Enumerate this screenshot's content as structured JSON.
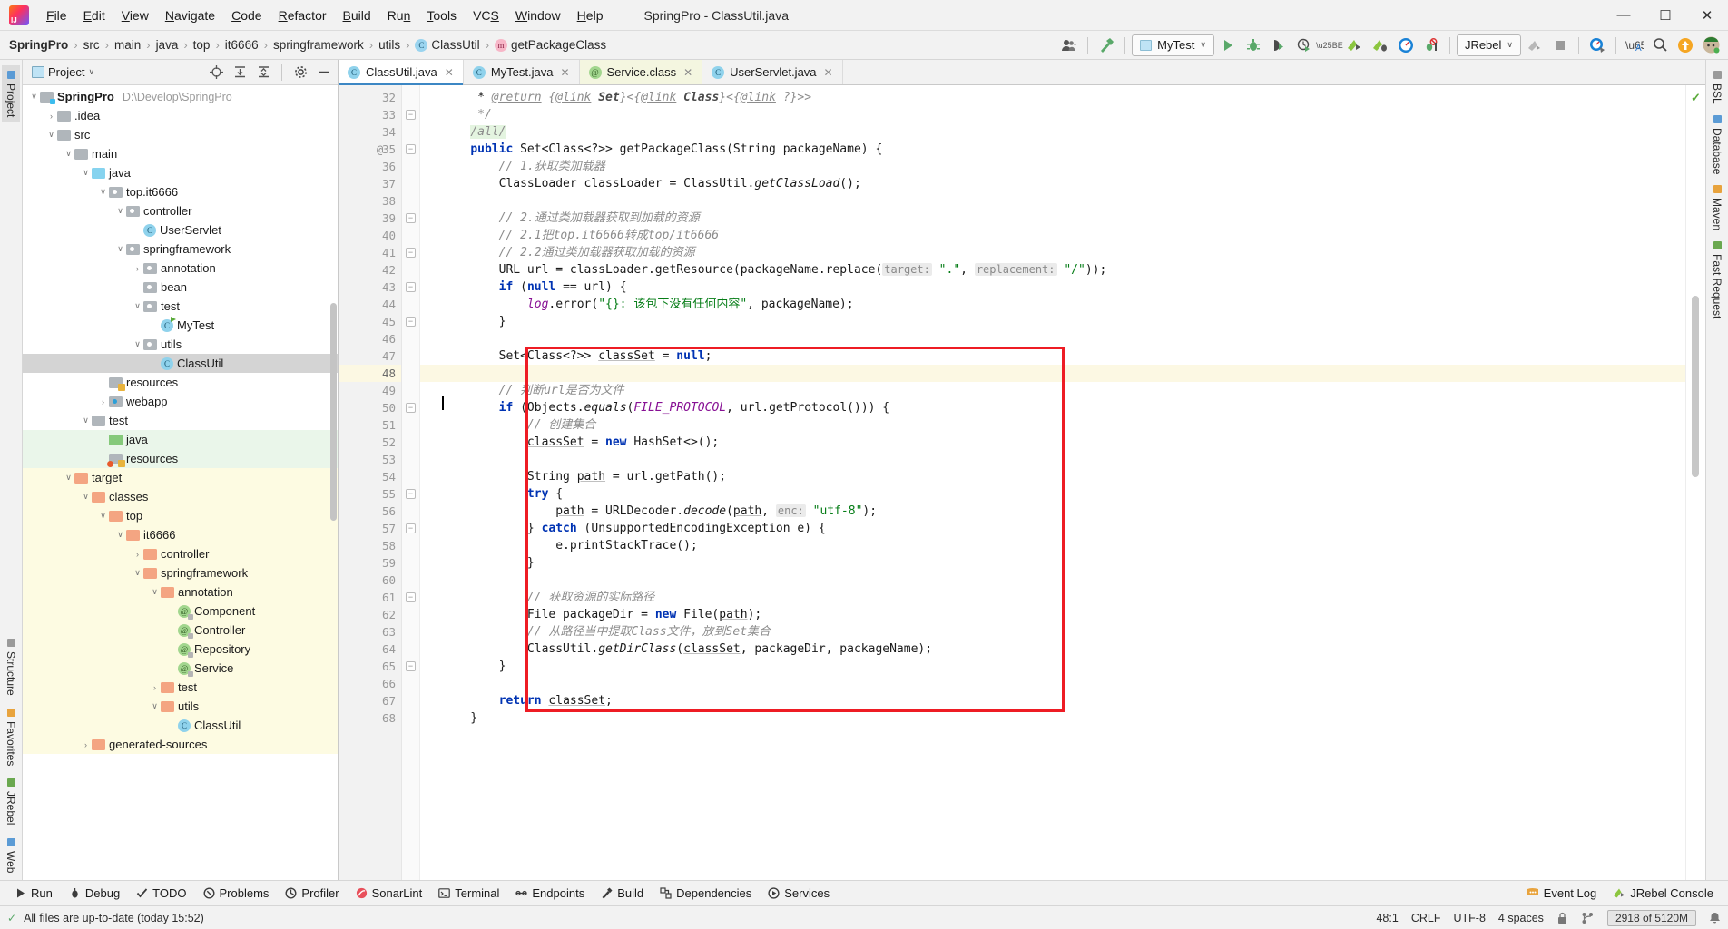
{
  "window": {
    "title": "SpringPro - ClassUtil.java",
    "minimize": "—",
    "maximize": "☐",
    "close": "✕"
  },
  "menu": {
    "items": [
      "File",
      "Edit",
      "View",
      "Navigate",
      "Code",
      "Refactor",
      "Build",
      "Run",
      "Tools",
      "VCS",
      "Window",
      "Help"
    ]
  },
  "breadcrumb": {
    "items": [
      "SpringPro",
      "src",
      "main",
      "java",
      "top",
      "it6666",
      "springframework",
      "utils",
      "ClassUtil",
      "getPackageClass"
    ],
    "separator": "›"
  },
  "toolbar": {
    "run_config": "MyTest",
    "jrebel": "JRebel",
    "caret": "∨",
    "icons": [
      "user-avatar-icon",
      "hammer-build-icon",
      "run-icon",
      "debug-icon",
      "run-with-coverage-icon",
      "profile-icon",
      "jrebel-run-icon",
      "jrebel-debug-icon",
      "jrebel-monitor-icon",
      "stop-debug-icon",
      "jrebel-deploy-icon",
      "stop-icon",
      "jrebel-console-icon",
      "translate-icon",
      "search-everywhere-icon",
      "update-icon",
      "account-avatar-icon"
    ]
  },
  "left_rail": {
    "items": [
      "Project",
      "Structure",
      "Favorites",
      "JRebel",
      "Web"
    ]
  },
  "right_rail": {
    "items": [
      "BSL",
      "Database",
      "Maven",
      "Fast Request"
    ]
  },
  "project_panel": {
    "title": "Project",
    "caret": "∨",
    "header_buttons": [
      "locate-icon",
      "expand-all-icon",
      "collapse-all-icon",
      "settings-gear-icon",
      "hide-icon"
    ],
    "tree": [
      {
        "depth": 0,
        "arrow": "∨",
        "icon": "folder-module",
        "icon_class": "fi gray src",
        "label": "SpringPro",
        "bold": true,
        "path": "D:\\Develop\\SpringPro",
        "row_class": ""
      },
      {
        "depth": 1,
        "arrow": "›",
        "icon": "folder",
        "icon_class": "fi gray",
        "label": ".idea",
        "bold": false,
        "path": "",
        "row_class": ""
      },
      {
        "depth": 1,
        "arrow": "∨",
        "icon": "folder",
        "icon_class": "fi gray",
        "label": "src",
        "bold": false,
        "path": "",
        "row_class": ""
      },
      {
        "depth": 2,
        "arrow": "∨",
        "icon": "folder",
        "icon_class": "fi gray",
        "label": "main",
        "bold": false,
        "path": "",
        "row_class": ""
      },
      {
        "depth": 3,
        "arrow": "∨",
        "icon": "folder-source",
        "icon_class": "fi blue",
        "label": "java",
        "bold": false,
        "path": "",
        "row_class": ""
      },
      {
        "depth": 4,
        "arrow": "∨",
        "icon": "folder-package",
        "icon_class": "fi gray pkg",
        "label": "top.it6666",
        "bold": false,
        "path": "",
        "row_class": ""
      },
      {
        "depth": 5,
        "arrow": "∨",
        "icon": "folder-package",
        "icon_class": "fi gray pkg",
        "label": "controller",
        "bold": false,
        "path": "",
        "row_class": ""
      },
      {
        "depth": 6,
        "arrow": "",
        "icon": "java-class",
        "icon_class": "ci",
        "label": "UserServlet",
        "bold": false,
        "path": "",
        "row_class": ""
      },
      {
        "depth": 5,
        "arrow": "∨",
        "icon": "folder-package",
        "icon_class": "fi gray pkg",
        "label": "springframework",
        "bold": false,
        "path": "",
        "row_class": ""
      },
      {
        "depth": 6,
        "arrow": "›",
        "icon": "folder-package",
        "icon_class": "fi gray pkg",
        "label": "annotation",
        "bold": false,
        "path": "",
        "row_class": ""
      },
      {
        "depth": 6,
        "arrow": "",
        "icon": "folder-package",
        "icon_class": "fi gray pkg",
        "label": "bean",
        "bold": false,
        "path": "",
        "row_class": ""
      },
      {
        "depth": 6,
        "arrow": "∨",
        "icon": "folder-package",
        "icon_class": "fi gray pkg",
        "label": "test",
        "bold": false,
        "path": "",
        "row_class": ""
      },
      {
        "depth": 7,
        "arrow": "",
        "icon": "java-class-runnable",
        "icon_class": "ci runnable",
        "label": "MyTest",
        "bold": false,
        "path": "",
        "row_class": ""
      },
      {
        "depth": 6,
        "arrow": "∨",
        "icon": "folder-package",
        "icon_class": "fi gray pkg",
        "label": "utils",
        "bold": false,
        "path": "",
        "row_class": ""
      },
      {
        "depth": 7,
        "arrow": "",
        "icon": "java-class",
        "icon_class": "ci",
        "label": "ClassUtil",
        "bold": false,
        "path": "",
        "row_class": "sel"
      },
      {
        "depth": 4,
        "arrow": "",
        "icon": "folder-resources",
        "icon_class": "fi gray res",
        "label": "resources",
        "bold": false,
        "path": "",
        "row_class": ""
      },
      {
        "depth": 4,
        "arrow": "›",
        "icon": "folder-webapp",
        "icon_class": "fi gray web",
        "label": "webapp",
        "bold": false,
        "path": "",
        "row_class": ""
      },
      {
        "depth": 3,
        "arrow": "∨",
        "icon": "folder",
        "icon_class": "fi gray",
        "label": "test",
        "bold": false,
        "path": "",
        "row_class": ""
      },
      {
        "depth": 4,
        "arrow": "",
        "icon": "folder-test-source",
        "icon_class": "fi green",
        "label": "java",
        "bold": false,
        "path": "",
        "row_class": "green"
      },
      {
        "depth": 4,
        "arrow": "",
        "icon": "folder-test-resources",
        "icon_class": "fi gray webres",
        "label": "resources",
        "bold": false,
        "path": "",
        "row_class": "green"
      },
      {
        "depth": 2,
        "arrow": "∨",
        "icon": "folder-excluded",
        "icon_class": "fi orange",
        "label": "target",
        "bold": false,
        "path": "",
        "row_class": "yellow"
      },
      {
        "depth": 3,
        "arrow": "∨",
        "icon": "folder-excluded",
        "icon_class": "fi orange",
        "label": "classes",
        "bold": false,
        "path": "",
        "row_class": "yellow"
      },
      {
        "depth": 4,
        "arrow": "∨",
        "icon": "folder-excluded",
        "icon_class": "fi orange",
        "label": "top",
        "bold": false,
        "path": "",
        "row_class": "yellow"
      },
      {
        "depth": 5,
        "arrow": "∨",
        "icon": "folder-excluded",
        "icon_class": "fi orange",
        "label": "it6666",
        "bold": false,
        "path": "",
        "row_class": "yellow"
      },
      {
        "depth": 6,
        "arrow": "›",
        "icon": "folder-excluded",
        "icon_class": "fi orange",
        "label": "controller",
        "bold": false,
        "path": "",
        "row_class": "yellow"
      },
      {
        "depth": 6,
        "arrow": "∨",
        "icon": "folder-excluded",
        "icon_class": "fi orange",
        "label": "springframework",
        "bold": false,
        "path": "",
        "row_class": "yellow"
      },
      {
        "depth": 7,
        "arrow": "∨",
        "icon": "folder-excluded",
        "icon_class": "fi orange",
        "label": "annotation",
        "bold": false,
        "path": "",
        "row_class": "yellow"
      },
      {
        "depth": 8,
        "arrow": "",
        "icon": "annotation-class",
        "icon_class": "ai",
        "label": "Component",
        "bold": false,
        "path": "",
        "row_class": "yellow"
      },
      {
        "depth": 8,
        "arrow": "",
        "icon": "annotation-class",
        "icon_class": "ai",
        "label": "Controller",
        "bold": false,
        "path": "",
        "row_class": "yellow"
      },
      {
        "depth": 8,
        "arrow": "",
        "icon": "annotation-class",
        "icon_class": "ai",
        "label": "Repository",
        "bold": false,
        "path": "",
        "row_class": "yellow"
      },
      {
        "depth": 8,
        "arrow": "",
        "icon": "annotation-class",
        "icon_class": "ai",
        "label": "Service",
        "bold": false,
        "path": "",
        "row_class": "yellow"
      },
      {
        "depth": 7,
        "arrow": "›",
        "icon": "folder-excluded",
        "icon_class": "fi orange",
        "label": "test",
        "bold": false,
        "path": "",
        "row_class": "yellow"
      },
      {
        "depth": 7,
        "arrow": "∨",
        "icon": "folder-excluded",
        "icon_class": "fi orange",
        "label": "utils",
        "bold": false,
        "path": "",
        "row_class": "yellow"
      },
      {
        "depth": 8,
        "arrow": "",
        "icon": "java-class",
        "icon_class": "ci",
        "label": "ClassUtil",
        "bold": false,
        "path": "",
        "row_class": "yellow"
      },
      {
        "depth": 3,
        "arrow": "›",
        "icon": "folder-excluded",
        "icon_class": "fi orange",
        "label": "generated-sources",
        "bold": false,
        "path": "",
        "row_class": "yellow"
      }
    ]
  },
  "editor": {
    "tabs": [
      {
        "label": "ClassUtil.java",
        "icon": "java-class-icon",
        "active": true,
        "style": "active",
        "close": "✕"
      },
      {
        "label": "MyTest.java",
        "icon": "java-class-icon",
        "active": false,
        "style": "",
        "close": "✕"
      },
      {
        "label": "Service.class",
        "icon": "annotation-class-icon",
        "active": false,
        "style": "classfile",
        "close": "✕"
      },
      {
        "label": "UserServlet.java",
        "icon": "java-class-icon",
        "active": false,
        "style": "",
        "close": "✕"
      }
    ],
    "first_line": 32,
    "current_line": 48,
    "line_numbers": [
      32,
      33,
      34,
      35,
      36,
      37,
      38,
      39,
      40,
      41,
      42,
      43,
      44,
      45,
      46,
      47,
      48,
      49,
      50,
      51,
      52,
      53,
      54,
      55,
      56,
      57,
      58,
      59,
      60,
      61,
      62,
      63,
      64,
      65,
      66,
      67,
      68
    ],
    "annotation_gutter": {
      "35": "@"
    },
    "fold_lines": [
      33,
      35,
      39,
      41,
      43,
      45,
      50,
      55,
      57,
      61,
      65
    ],
    "code_lines": [
      {
        "n": 32,
        "html": "     * <span class=\"jdoclink\">@return</span> <span class=\"jdoc\">{<span class=\"jdoclink\">@link</span> <span class=\"jdocb\">Set</span>}&lt;{<span class=\"jdoclink\">@link</span> <span class=\"jdocb\">Class</span>}&lt;{<span class=\"jdoclink\">@link</span> ?}&gt;&gt;</span>"
      },
      {
        "n": 33,
        "html": "     <span class=\"cm\">*/</span>"
      },
      {
        "n": 34,
        "html": "    <span class=\"cm greenbg\">/all/</span>"
      },
      {
        "n": 35,
        "html": "    <span class=\"kw\">public</span> Set&lt;Class&lt;?&gt;&gt; getPackageClass(String packageName) {"
      },
      {
        "n": 36,
        "html": "        <span class=\"cm\">// 1.获取类加载器</span>"
      },
      {
        "n": 37,
        "html": "        ClassLoader classLoader = ClassUtil.<span class=\"mth\">getClassLoad</span>();"
      },
      {
        "n": 38,
        "html": ""
      },
      {
        "n": 39,
        "html": "        <span class=\"cm\">// 2.通过类加载器获取到加载的资源</span>"
      },
      {
        "n": 40,
        "html": "        <span class=\"cm\">// 2.1把top.it6666转成top/it6666</span>"
      },
      {
        "n": 41,
        "html": "        <span class=\"cm\">// 2.2通过类加载器获取加载的资源</span>"
      },
      {
        "n": 42,
        "html": "        URL url = classLoader.getResource(packageName.replace(<span class=\"hint\">target:</span> <span class=\"str\">\".\"</span>, <span class=\"hint\">replacement:</span> <span class=\"str\">\"/\"</span>));"
      },
      {
        "n": 43,
        "html": "        <span class=\"kw\">if</span> (<span class=\"kw\">null</span> == url) {"
      },
      {
        "n": 44,
        "html": "            <span class=\"log\">log</span>.error(<span class=\"str\">\"{}: 该包下没有任何内容\"</span>, packageName);"
      },
      {
        "n": 45,
        "html": "        }"
      },
      {
        "n": 46,
        "html": ""
      },
      {
        "n": 47,
        "html": "        Set&lt;Class&lt;?&gt;&gt; <span class=\"loc\">classSet</span> = <span class=\"kw\">null</span>;"
      },
      {
        "n": 48,
        "html": ""
      },
      {
        "n": 49,
        "html": "        <span class=\"cm\">// 判断url是否为文件</span>"
      },
      {
        "n": 50,
        "html": "        <span class=\"kw\">if</span> (Objects.<span class=\"mth\">equals</span>(<span class=\"sfld\">FILE_PROTOCOL</span>, url.getProtocol())) {"
      },
      {
        "n": 51,
        "html": "            <span class=\"cm\">// 创建集合</span>"
      },
      {
        "n": 52,
        "html": "            <span class=\"loc\">classSet</span> = <span class=\"kw\">new</span> HashSet&lt;&gt;();"
      },
      {
        "n": 53,
        "html": ""
      },
      {
        "n": 54,
        "html": "            String <span class=\"loc\">path</span> = url.getPath();"
      },
      {
        "n": 55,
        "html": "            <span class=\"kw\">try</span> {"
      },
      {
        "n": 56,
        "html": "                <span class=\"loc\">path</span> = URLDecoder.<span class=\"mth\">decode</span>(<span class=\"loc\">path</span>, <span class=\"hint\">enc:</span> <span class=\"str\">\"utf-8\"</span>);"
      },
      {
        "n": 57,
        "html": "            } <span class=\"kw\">catch</span> (UnsupportedEncodingException e) {"
      },
      {
        "n": 58,
        "html": "                e.printStackTrace();"
      },
      {
        "n": 59,
        "html": "            }"
      },
      {
        "n": 60,
        "html": ""
      },
      {
        "n": 61,
        "html": "            <span class=\"cm\">// 获取资源的实际路径</span>"
      },
      {
        "n": 62,
        "html": "            File packageDir = <span class=\"kw\">new</span> File(<span class=\"loc\">path</span>);"
      },
      {
        "n": 63,
        "html": "            <span class=\"cm\">// 从路径当中提取Class文件，放到Set集合</span>"
      },
      {
        "n": 64,
        "html": "            ClassUtil.<span class=\"mth\">getDirClass</span>(<span class=\"loc\">classSet</span>, packageDir, packageName);"
      },
      {
        "n": 65,
        "html": "        }"
      },
      {
        "n": 66,
        "html": ""
      },
      {
        "n": 67,
        "html": "        <span class=\"kw\">return</span> <span class=\"loc\">classSet</span>;"
      },
      {
        "n": 68,
        "html": "    }"
      }
    ],
    "highlight_box_color": "#ee1c24"
  },
  "tool_window_bar": {
    "items": [
      {
        "label": "Run",
        "icon": "run-icon"
      },
      {
        "label": "Debug",
        "icon": "debug-icon"
      },
      {
        "label": "TODO",
        "icon": "todo-icon"
      },
      {
        "label": "Problems",
        "icon": "problems-icon"
      },
      {
        "label": "Profiler",
        "icon": "profiler-icon"
      },
      {
        "label": "SonarLint",
        "icon": "sonarlint-icon"
      },
      {
        "label": "Terminal",
        "icon": "terminal-icon"
      },
      {
        "label": "Endpoints",
        "icon": "endpoints-icon"
      },
      {
        "label": "Build",
        "icon": "build-icon"
      },
      {
        "label": "Dependencies",
        "icon": "dependencies-icon"
      },
      {
        "label": "Services",
        "icon": "services-icon"
      }
    ],
    "right_items": [
      {
        "label": "Event Log",
        "icon": "event-log-icon"
      },
      {
        "label": "JRebel Console",
        "icon": "jrebel-console-icon"
      }
    ]
  },
  "status_bar": {
    "message": "All files are up-to-date (today 15:52)",
    "caret_position": "48:1",
    "line_separator": "CRLF",
    "encoding": "UTF-8",
    "indent": "4 spaces",
    "memory": "2918 of 5120M",
    "icons": [
      "lock-icon",
      "git-branch-icon",
      "notifications-icon"
    ]
  }
}
